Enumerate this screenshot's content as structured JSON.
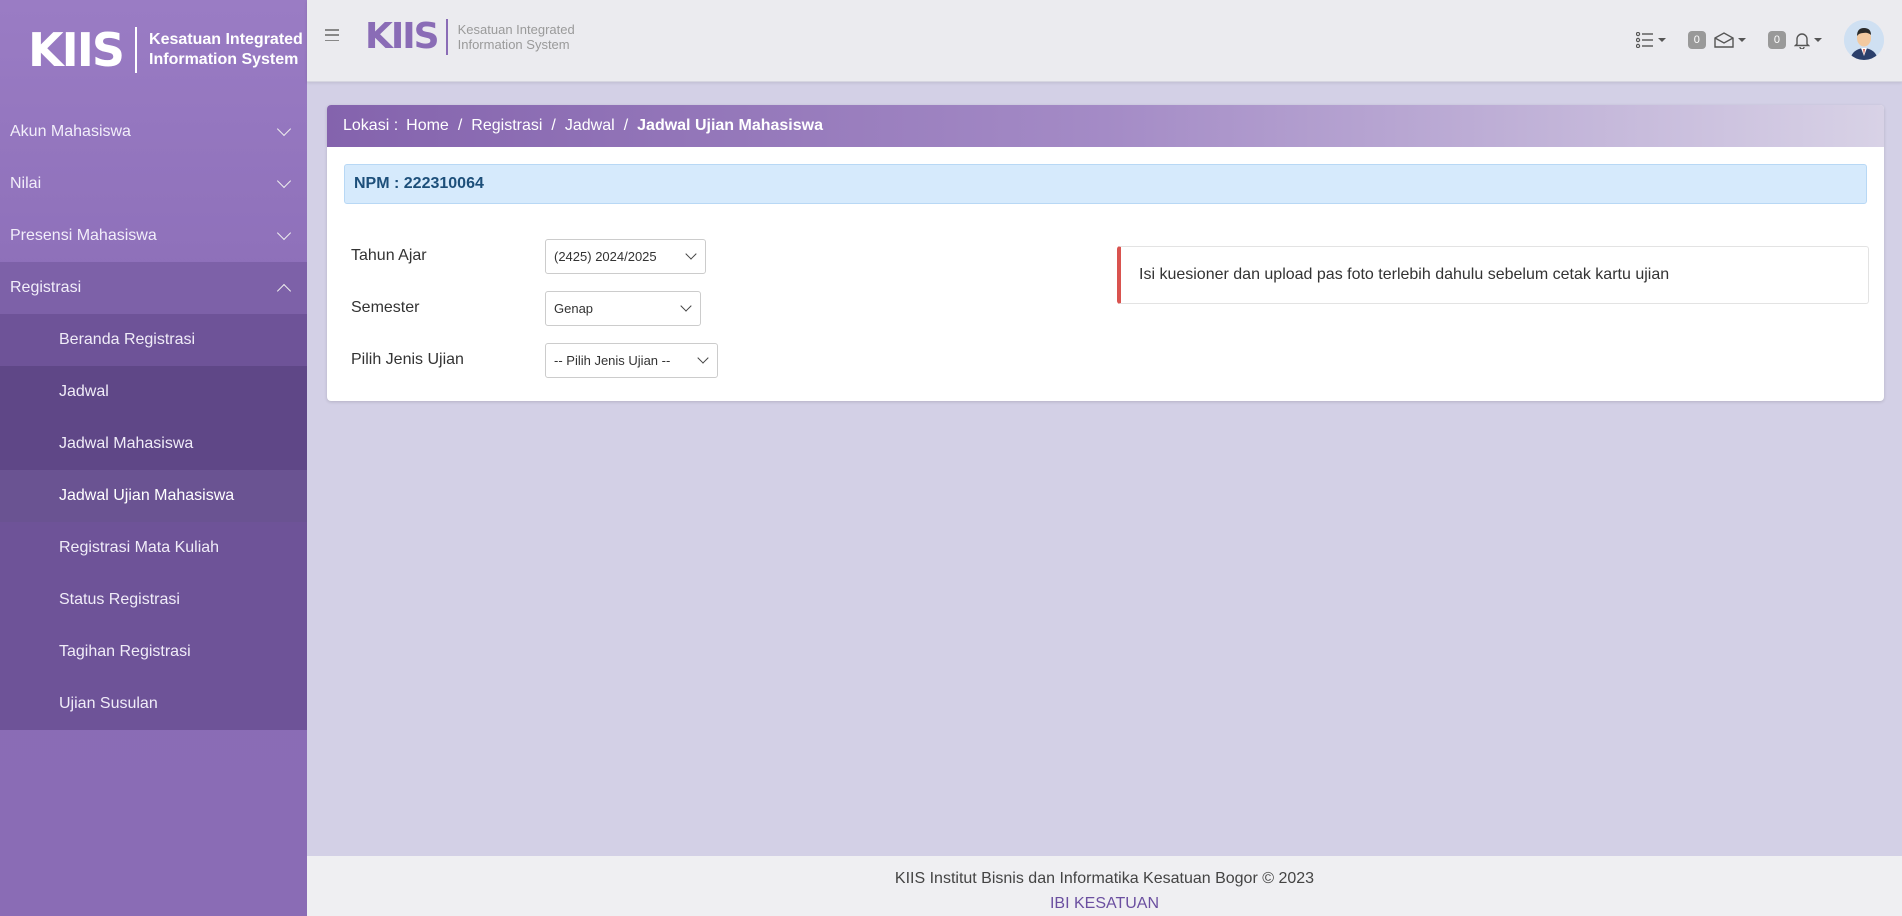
{
  "brand": {
    "logo": "KIIS",
    "line1": "Kesatuan Integrated",
    "line2": "Information System"
  },
  "sidebar": {
    "items": [
      {
        "label": "Akun Mahasiswa"
      },
      {
        "label": "Nilai"
      },
      {
        "label": "Presensi Mahasiswa"
      },
      {
        "label": "Registrasi"
      }
    ],
    "registrasi": {
      "beranda": "Beranda Registrasi",
      "jadwal": "Jadwal",
      "jadwal_mahasiswa": "Jadwal Mahasiswa",
      "jadwal_ujian": "Jadwal Ujian Mahasiswa",
      "registrasi_mk": "Registrasi Mata Kuliah",
      "status": "Status Registrasi",
      "tagihan": "Tagihan Registrasi",
      "ujian_susulan": "Ujian Susulan"
    }
  },
  "topbar": {
    "messages_count": "0",
    "notifications_count": "0"
  },
  "breadcrumb": {
    "prefix": "Lokasi :",
    "home": "Home",
    "registrasi": "Registrasi",
    "jadwal": "Jadwal",
    "current": "Jadwal Ujian Mahasiswa",
    "sep": "/"
  },
  "npm": "NPM : 222310064",
  "form": {
    "tahun_ajar_label": "Tahun Ajar",
    "tahun_ajar_value": "(2425) 2024/2025",
    "semester_label": "Semester",
    "semester_value": "Genap",
    "jenis_ujian_label": "Pilih Jenis Ujian",
    "jenis_ujian_value": "-- Pilih Jenis Ujian --"
  },
  "alert": "Isi kuesioner dan upload pas foto terlebih dahulu sebelum cetak kartu ujian",
  "footer": {
    "copyright": "KIIS Institut Bisnis dan Informatika Kesatuan Bogor © 2023",
    "link": "IBI KESATUAN"
  },
  "colors": {
    "sidebar": "#8a6cb6",
    "accent": "#8463ad",
    "alert_border": "#d9534f",
    "npm_bg": "#d6eafc"
  }
}
